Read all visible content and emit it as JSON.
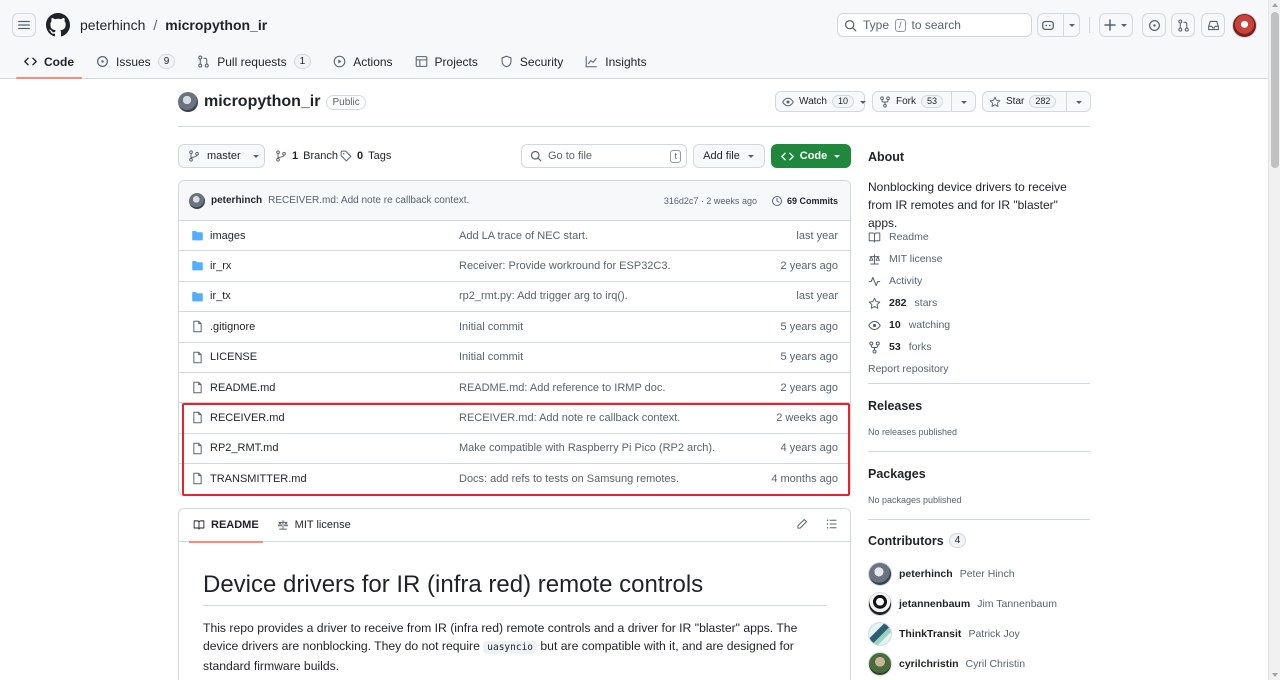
{
  "header": {
    "owner": "peterhinch",
    "separator": "/",
    "repo": "micropython_ir",
    "search": {
      "prefix": "Type",
      "key": "/",
      "suffix": "to search"
    }
  },
  "tabs": [
    {
      "label": "Code",
      "icon": "code-icon",
      "count": null
    },
    {
      "label": "Issues",
      "icon": "issue-icon",
      "count": "9"
    },
    {
      "label": "Pull requests",
      "icon": "pull-request-icon",
      "count": "1"
    },
    {
      "label": "Actions",
      "icon": "play-icon",
      "count": null
    },
    {
      "label": "Projects",
      "icon": "table-icon",
      "count": null
    },
    {
      "label": "Security",
      "icon": "shield-icon",
      "count": null
    },
    {
      "label": "Insights",
      "icon": "graph-icon",
      "count": null
    }
  ],
  "repo": {
    "name": "micropython_ir",
    "visibility": "Public",
    "watch": {
      "label": "Watch",
      "count": "10"
    },
    "fork": {
      "label": "Fork",
      "count": "53"
    },
    "star": {
      "label": "Star",
      "count": "282"
    }
  },
  "toolbar": {
    "branch": "master",
    "branches_count": "1",
    "branches_label": "Branch",
    "tags_count": "0",
    "tags_label": "Tags",
    "goto_placeholder": "Go to file",
    "goto_key": "t",
    "add_file": "Add file",
    "code": "Code"
  },
  "commit": {
    "author": "peterhinch",
    "message": "RECEIVER.md: Add note re callback context.",
    "sha_time": "316d2c7 · 2 weeks ago",
    "commits": "69 Commits"
  },
  "files": [
    {
      "type": "dir",
      "name": "images",
      "message": "Add LA trace of NEC start.",
      "date": "last year"
    },
    {
      "type": "dir",
      "name": "ir_rx",
      "message": "Receiver: Provide workround for ESP32C3.",
      "date": "2 years ago"
    },
    {
      "type": "dir",
      "name": "ir_tx",
      "message": "rp2_rmt.py: Add trigger arg to irq().",
      "date": "last year"
    },
    {
      "type": "file",
      "name": ".gitignore",
      "message": "Initial commit",
      "date": "5 years ago"
    },
    {
      "type": "file",
      "name": "LICENSE",
      "message": "Initial commit",
      "date": "5 years ago"
    },
    {
      "type": "file",
      "name": "README.md",
      "message": "README.md: Add reference to IRMP doc.",
      "date": "2 years ago"
    },
    {
      "type": "file",
      "name": "RECEIVER.md",
      "message": "RECEIVER.md: Add note re callback context.",
      "date": "2 weeks ago"
    },
    {
      "type": "file",
      "name": "RP2_RMT.md",
      "message": "Make compatible with Raspberry Pi Pico (RP2 arch).",
      "date": "4 years ago"
    },
    {
      "type": "file",
      "name": "TRANSMITTER.md",
      "message": "Docs: add refs to tests on Samsung remotes.",
      "date": "4 months ago"
    }
  ],
  "readme": {
    "tab_readme": "README",
    "tab_license": "MIT license",
    "heading": "Device drivers for IR (infra red) remote controls",
    "para_part1": "This repo provides a driver to receive from IR (infra red) remote controls and a driver for IR \"blaster\" apps. The device drivers are nonblocking. They do not require ",
    "para_code": "uasyncio",
    "para_part2": " but are compatible with it, and are designed for standard firmware builds."
  },
  "sidebar": {
    "about_title": "About",
    "description": "Nonblocking device drivers to receive from IR remotes and for IR \"blaster\" apps.",
    "links": [
      {
        "icon": "book-icon",
        "bold": "",
        "text": "Readme"
      },
      {
        "icon": "law-icon",
        "bold": "",
        "text": "MIT license"
      },
      {
        "icon": "pulse-icon",
        "bold": "",
        "text": "Activity"
      },
      {
        "icon": "star-icon",
        "bold": "282",
        "text": "stars"
      },
      {
        "icon": "eye-icon",
        "bold": "10",
        "text": "watching"
      },
      {
        "icon": "fork-icon",
        "bold": "53",
        "text": "forks"
      }
    ],
    "report": "Report repository",
    "releases_title": "Releases",
    "releases_note": "No releases published",
    "packages_title": "Packages",
    "packages_note": "No packages published",
    "contributors_title": "Contributors",
    "contributors_count": "4",
    "contributors": [
      {
        "login": "peterhinch",
        "name": "Peter Hinch"
      },
      {
        "login": "jetannenbaum",
        "name": "Jim Tannenbaum"
      },
      {
        "login": "ThinkTransit",
        "name": "Patrick Joy"
      },
      {
        "login": "cyrilchristin",
        "name": "Cyril Christin"
      }
    ]
  },
  "colors": {
    "accent_green": "#1f883d",
    "underline": "#fd8c73",
    "highlight": "#e02626",
    "folder": "#54aeff"
  }
}
